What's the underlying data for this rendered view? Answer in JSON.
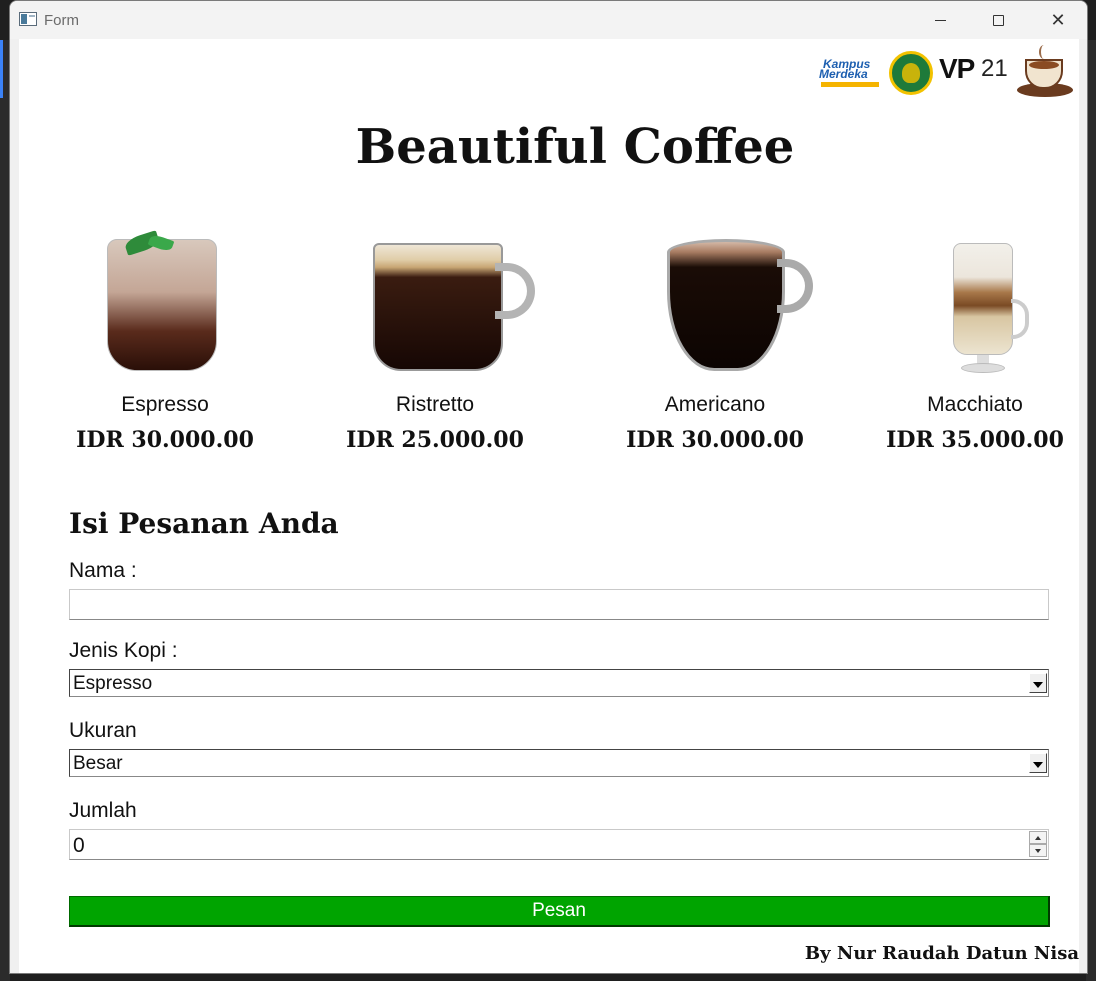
{
  "window": {
    "title": "Form",
    "controls": {
      "minimize": "minimize",
      "maximize": "maximize",
      "close": "close"
    }
  },
  "header": {
    "logos": [
      "kampus-merdeka-logo",
      "university-seal-logo",
      "vp21-logo",
      "coffee-cup-logo"
    ],
    "logo_text": {
      "kampus": "Kampus",
      "merdeka": "Merdeka",
      "vp": "VP",
      "vp_num": "21"
    },
    "title": "Beautiful Coffee"
  },
  "products": [
    {
      "name": "Espresso",
      "price": "IDR 30.000.00",
      "icon": "iced-coffee-glass-icon"
    },
    {
      "name": "Ristretto",
      "price": "IDR 25.000.00",
      "icon": "coffee-mug-icon"
    },
    {
      "name": "Americano",
      "price": "IDR 30.000.00",
      "icon": "coffee-mug-icon"
    },
    {
      "name": "Macchiato",
      "price": "IDR 35.000.00",
      "icon": "latte-glass-icon"
    }
  ],
  "form": {
    "title": "Isi Pesanan Anda",
    "nama_label": "Nama :",
    "nama_value": "",
    "jenis_label": "Jenis Kopi :",
    "jenis_value": "Espresso",
    "ukuran_label": "Ukuran",
    "ukuran_value": "Besar",
    "jumlah_label": "Jumlah",
    "jumlah_value": "0",
    "submit_label": "Pesan"
  },
  "footer": {
    "credit": "By Nur Raudah Datun Nisa"
  },
  "colors": {
    "submit_bg": "#00a400",
    "background": "#ffffff",
    "text": "#111111"
  }
}
